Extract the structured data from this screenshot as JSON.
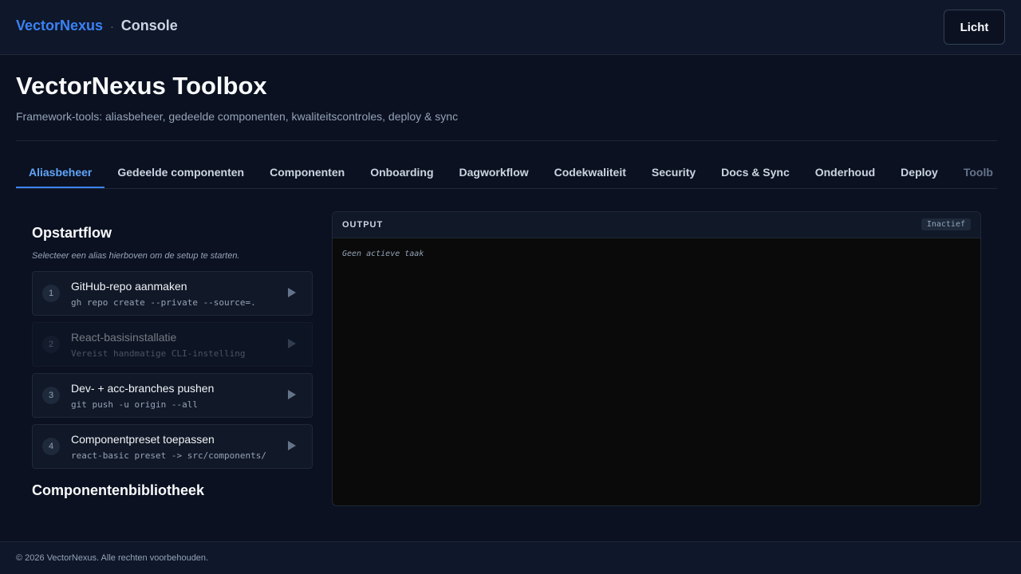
{
  "header": {
    "brand": "VectorNexus",
    "separator": "·",
    "section": "Console",
    "theme_button": "Licht"
  },
  "page": {
    "title": "VectorNexus Toolbox",
    "subtitle": "Framework-tools: aliasbeheer, gedeelde componenten, kwaliteitscontroles, deploy & sync"
  },
  "tabs": [
    {
      "label": "Aliasbeheer"
    },
    {
      "label": "Gedeelde componenten"
    },
    {
      "label": "Componenten"
    },
    {
      "label": "Onboarding"
    },
    {
      "label": "Dagworkflow"
    },
    {
      "label": "Codekwaliteit"
    },
    {
      "label": "Security"
    },
    {
      "label": "Docs & Sync"
    },
    {
      "label": "Onderhoud"
    },
    {
      "label": "Deploy"
    },
    {
      "label": "Toolb"
    }
  ],
  "startup_flow": {
    "title": "Opstartflow",
    "hint": "Selecteer een alias hierboven om de setup te starten.",
    "steps": [
      {
        "number": "1",
        "title": "GitHub-repo aanmaken",
        "command": "gh repo create --private --source=."
      },
      {
        "number": "2",
        "title": "React-basisinstallatie",
        "command": "Vereist handmatige CLI-instelling"
      },
      {
        "number": "3",
        "title": "Dev- + acc-branches pushen",
        "command": "git push -u origin --all"
      },
      {
        "number": "4",
        "title": "Componentpreset toepassen",
        "command": "react-basic preset -> src/components/"
      }
    ]
  },
  "library": {
    "title": "Componentenbibliotheek"
  },
  "output": {
    "label": "OUTPUT",
    "status": "Inactief",
    "message": "Geen actieve taak"
  },
  "footer": {
    "text": "© 2026 VectorNexus. Alle rechten voorbehouden."
  },
  "colors": {
    "accent": "#3b82f6",
    "background": "#0b1120"
  }
}
